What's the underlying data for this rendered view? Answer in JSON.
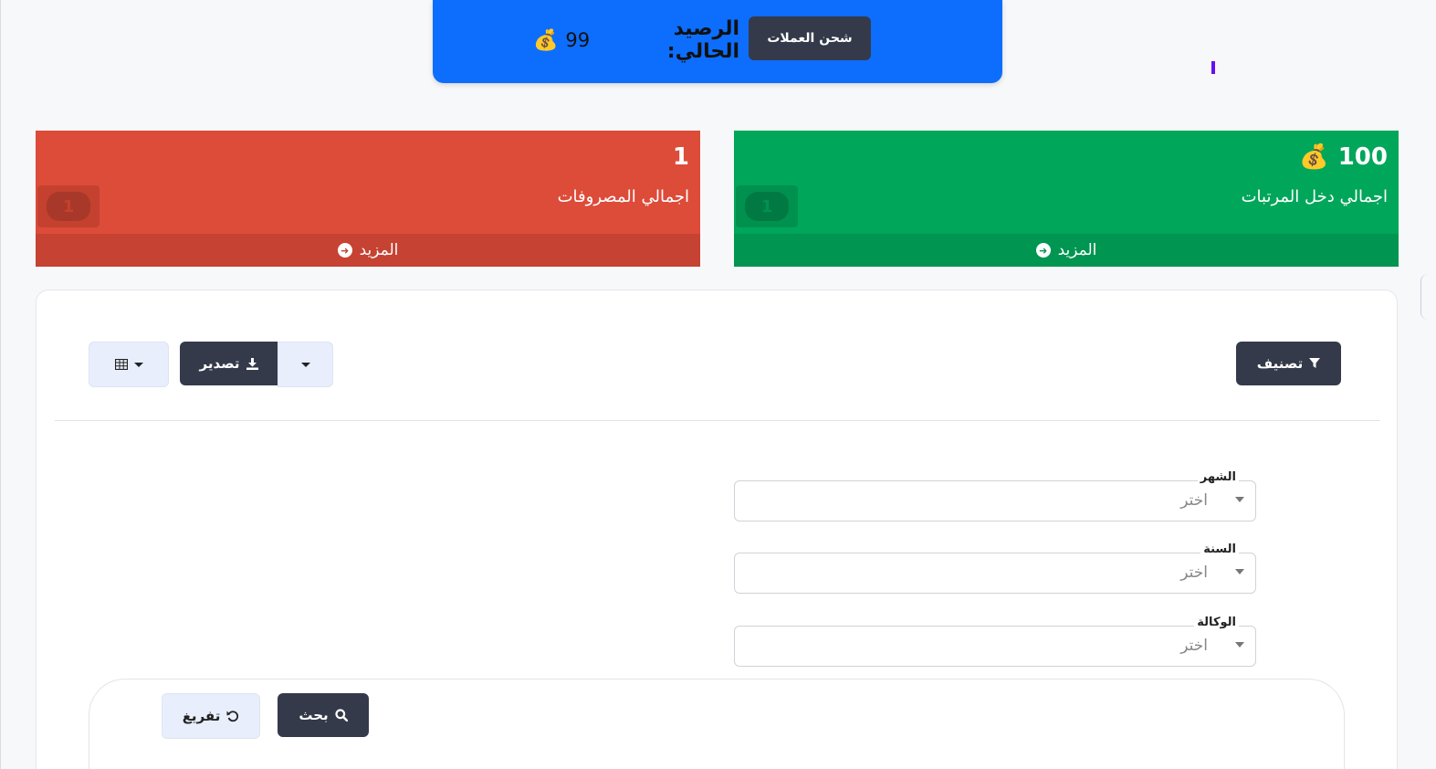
{
  "topbar": {
    "recharge_label": "شحن العملات",
    "balance_label": "الرصيد الحالي:",
    "balance_value": "99",
    "coin_icon": "💰"
  },
  "cards": {
    "income": {
      "value": "100",
      "coin_icon": "💰",
      "caption": "اجمالي دخل المرتبات",
      "more_label": "المزيد",
      "money_symbol": "1",
      "color": "#00a65a"
    },
    "expenses": {
      "value": "1",
      "caption": "اجمالي المصروفات",
      "more_label": "المزيد",
      "money_symbol": "1",
      "color": "#dd4b39"
    }
  },
  "toolbar": {
    "filter_label": "تصنيف",
    "export_label": "تصدير"
  },
  "filters": {
    "month": {
      "label": "الشهر",
      "value": "اختر"
    },
    "year": {
      "label": "السنة",
      "value": "اختر"
    },
    "agency": {
      "label": "الوكالة",
      "value": "اختر"
    }
  },
  "actions": {
    "search_label": "بحث",
    "reset_label": "تفريغ"
  },
  "colors": {
    "primary": "#0d6efd",
    "dark_button": "#343a4a",
    "accent": "#6610f2"
  }
}
